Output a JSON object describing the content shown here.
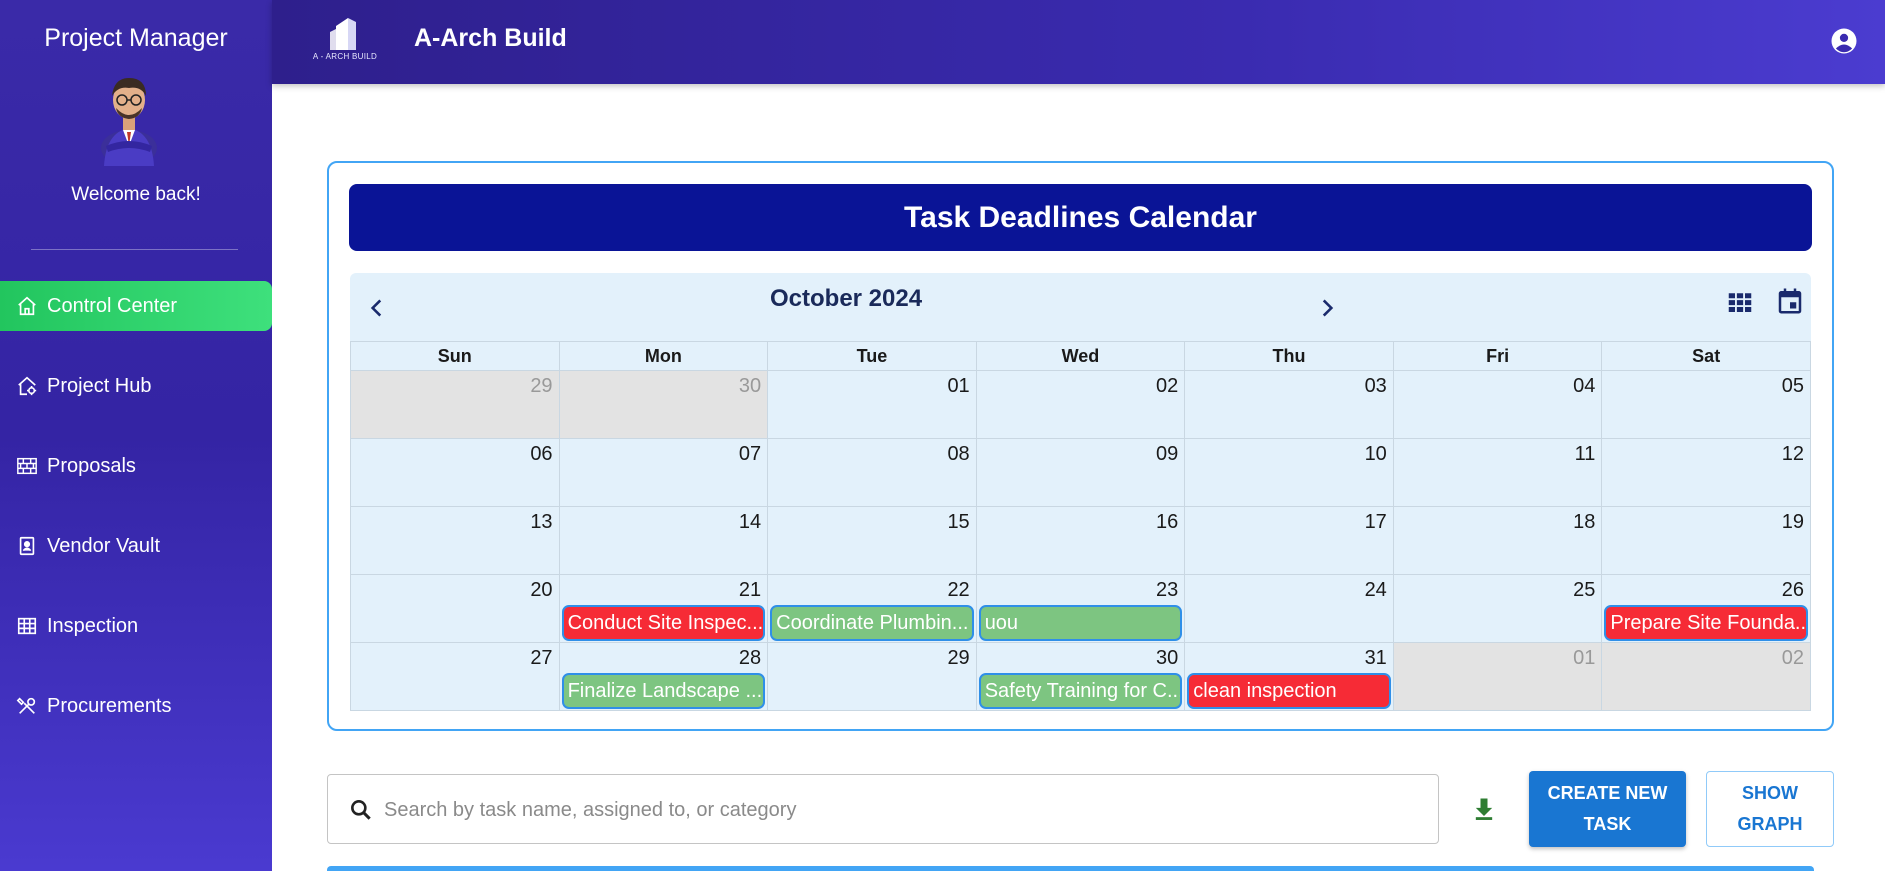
{
  "sidebar": {
    "title": "Project Manager",
    "welcome": "Welcome back!",
    "items": [
      {
        "label": "Control Center",
        "icon": "home-icon",
        "active": true
      },
      {
        "label": "Project Hub",
        "icon": "house-gear-icon"
      },
      {
        "label": "Proposals",
        "icon": "brick-wall-icon"
      },
      {
        "label": "Vendor Vault",
        "icon": "contact-book-icon"
      },
      {
        "label": "Inspection",
        "icon": "table-grid-icon"
      },
      {
        "label": "Procurements",
        "icon": "tools-icon"
      }
    ]
  },
  "header": {
    "logo_text": "A - ARCH BUILD",
    "brand": "A-Arch Build",
    "account_icon": "account-circle-icon"
  },
  "calendar": {
    "title": "Task Deadlines Calendar",
    "month": "October 2024",
    "weekdays": [
      "Sun",
      "Mon",
      "Tue",
      "Wed",
      "Thu",
      "Fri",
      "Sat"
    ],
    "weeks": [
      [
        {
          "d": "29",
          "other": true
        },
        {
          "d": "30",
          "other": true
        },
        {
          "d": "01"
        },
        {
          "d": "02"
        },
        {
          "d": "03"
        },
        {
          "d": "04"
        },
        {
          "d": "05"
        }
      ],
      [
        {
          "d": "06"
        },
        {
          "d": "07"
        },
        {
          "d": "08"
        },
        {
          "d": "09"
        },
        {
          "d": "10"
        },
        {
          "d": "11"
        },
        {
          "d": "12"
        }
      ],
      [
        {
          "d": "13"
        },
        {
          "d": "14"
        },
        {
          "d": "15"
        },
        {
          "d": "16"
        },
        {
          "d": "17"
        },
        {
          "d": "18"
        },
        {
          "d": "19"
        }
      ],
      [
        {
          "d": "20"
        },
        {
          "d": "21",
          "event": "Conduct Site Inspec...",
          "color": "red"
        },
        {
          "d": "22",
          "event": "Coordinate Plumbin...",
          "color": "green"
        },
        {
          "d": "23",
          "event": "uou",
          "color": "green"
        },
        {
          "d": "24"
        },
        {
          "d": "25"
        },
        {
          "d": "26",
          "event": "Prepare Site Founda...",
          "color": "red"
        }
      ],
      [
        {
          "d": "27"
        },
        {
          "d": "28",
          "event": "Finalize Landscape ...",
          "color": "green"
        },
        {
          "d": "29"
        },
        {
          "d": "30",
          "event": "Safety Training for C...",
          "color": "green"
        },
        {
          "d": "31",
          "event": "clean inspection",
          "color": "red"
        },
        {
          "d": "01",
          "other": true
        },
        {
          "d": "02",
          "other": true
        }
      ]
    ]
  },
  "search": {
    "placeholder": "Search by task name, assigned to, or category"
  },
  "actions": {
    "create_label": "CREATE NEW\nTASK",
    "graph_label": "SHOW\nGRAPH"
  },
  "colors": {
    "sidebar": "#3a2aa8",
    "active_nav": "#2ed66f",
    "title_bar": "#0a1496",
    "event_red": "#f62b36",
    "event_green": "#7dc581",
    "primary": "#1976d2"
  }
}
